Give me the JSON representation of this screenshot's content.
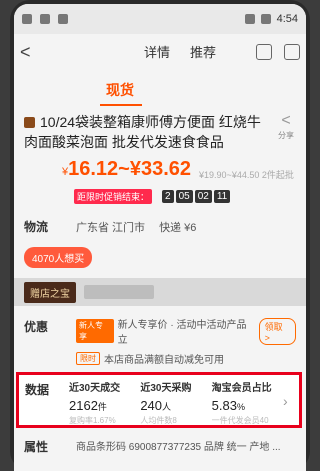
{
  "status": {
    "time": "4:54"
  },
  "nav": {
    "back": "<",
    "tabs": [
      "详情",
      "推荐"
    ]
  },
  "subtab": "现货",
  "product": {
    "title": "10/24袋装整箱康师傅方便面 红烧牛肉面酸菜泡面 批发代发速食食品",
    "share": "分享",
    "price_symbol": "¥",
    "price_range": "16.12~¥33.62",
    "price_blur": "¥19.90~¥44.50 2件起批",
    "countdown_label": "距限时促销结束：",
    "countdown_prefix": "2",
    "countdown": [
      "05",
      "02",
      "11"
    ]
  },
  "logistics": {
    "label": "物流",
    "from": "广东省 江门市",
    "shipping": "快递 ¥6"
  },
  "promo_tag": "4070人想买",
  "shop": {
    "button": "赠店之宝"
  },
  "youhui": {
    "label": "优惠",
    "line1_tag": "新人专享",
    "line1_text": "新人专享价 · 活动中活动产品立",
    "line1_btn": "领取 >",
    "line2_tag": "限时",
    "line2_text": "本店商品满额自动减免可用"
  },
  "data": {
    "label": "数据",
    "cols": [
      {
        "h": "近30天成交",
        "v": "2162",
        "unit": "件",
        "sub": "复购率1.67%"
      },
      {
        "h": "近30天采购",
        "v": "240",
        "unit": "人",
        "sub": "人均件数8"
      },
      {
        "h": "淘宝会员占比",
        "v": "5.83",
        "unit": "%",
        "sub": "一件代发会员40"
      }
    ]
  },
  "attr": {
    "label": "属性",
    "text": "商品条形码 6900877377235 品牌 统一 产地 ..."
  }
}
